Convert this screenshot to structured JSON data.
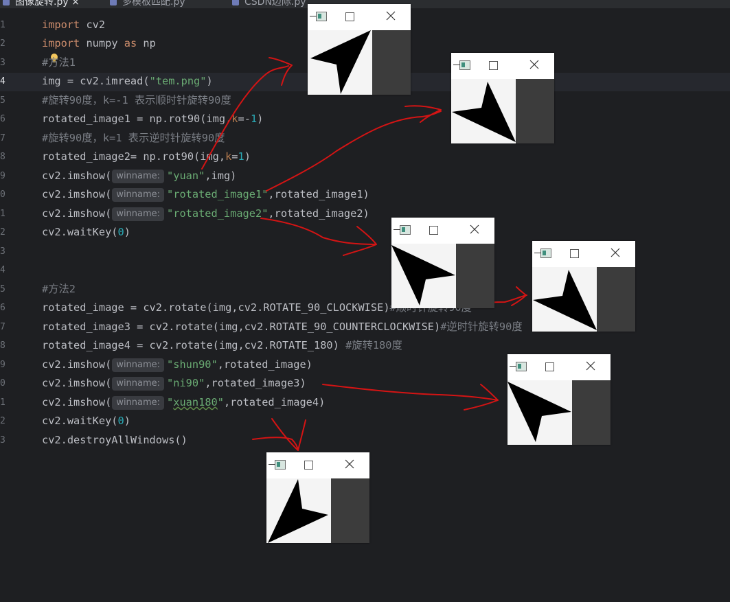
{
  "tabs": [
    {
      "label": "图像旋转.py",
      "active": true
    },
    {
      "label": "多模板匹配.py",
      "active": false
    },
    {
      "label": "CSDN边际.py",
      "active": false
    }
  ],
  "line_numbers": [
    "1",
    "2",
    "3",
    "4",
    "5",
    "6",
    "7",
    "8",
    "9",
    "0",
    "1",
    "2",
    "3",
    "4",
    "5",
    "6",
    "7",
    "8",
    "9",
    "0",
    "1",
    "2",
    "3"
  ],
  "current_line": 4,
  "hint_label": "winname:",
  "code": {
    "l1_kw": "import",
    "l1_rest": " cv2",
    "l2_kw1": "import",
    "l2_mid": " numpy ",
    "l2_kw2": "as",
    "l2_rest": " np",
    "l3_cm": "#方法1",
    "l4_pre": "img = cv2.imread(",
    "l4_str": "\"tem.png\"",
    "l4_post": ")",
    "l5_cm": "#旋转90度，k=-1 表示顺时针旋转90度",
    "l6_pre": "rotated_image1 = np.rot90(img,",
    "l6_prm": "k",
    "l6_eq": "=-",
    "l6_num": "1",
    "l6_post": ")",
    "l7_cm": "#旋转90度，k=1 表示逆时针旋转90度",
    "l8_pre": "rotated_image2= np.rot90(img,",
    "l8_prm": "k",
    "l8_eq": "=",
    "l8_num": "1",
    "l8_post": ")",
    "l9_pre": "cv2.imshow(",
    "l9_str": "\"yuan\"",
    "l9_post": ",img)",
    "l10_pre": "cv2.imshow(",
    "l10_str": "\"rotated_image1\"",
    "l10_post": ",rotated_image1)",
    "l11_pre": "cv2.imshow(",
    "l11_str": "\"rotated_image2\"",
    "l11_post": ",rotated_image2)",
    "l12_pre": "cv2.waitKey(",
    "l12_num": "0",
    "l12_post": ")",
    "l15_cm": "#方法2",
    "l16_code": "rotated_image = cv2.rotate(img,cv2.ROTATE_90_CLOCKWISE)",
    "l16_cm": "#顺时针旋转90度",
    "l17_code": "rotated_image3 = cv2.rotate(img,cv2.ROTATE_90_COUNTERCLOCKWISE)",
    "l17_cm": "#逆时针旋转90度",
    "l18_code": "rotated_image4 = cv2.rotate(img,cv2.ROTATE_180) ",
    "l18_cm": "#旋转180度",
    "l19_pre": "cv2.imshow(",
    "l19_str": "\"shun90\"",
    "l19_post": ",rotated_image)",
    "l20_pre": "cv2.imshow(",
    "l20_str": "\"ni90\"",
    "l20_post": ",rotated_image3)",
    "l21_pre": "cv2.imshow(",
    "l21_q1": "\"",
    "l21_str": "xuan180",
    "l21_q2": "\"",
    "l21_post": ",rotated_image4)",
    "l22_pre": "cv2.waitKey(",
    "l22_num": "0",
    "l22_post": ")",
    "l23_code": "cv2.destroyAllWindows()"
  },
  "colors": {
    "background": "#1e1f22",
    "keyword": "#cf8e6d",
    "string": "#6aab73",
    "number": "#2aacb8",
    "comment": "#7a7e85",
    "annotation_arrows": "#d41414",
    "image_dark_panel": "#3c3c3c"
  },
  "windows": [
    {
      "id": "win-yuan",
      "rotation": 0
    },
    {
      "id": "win-rotated-image1",
      "rotation": -90
    },
    {
      "id": "win-rotated-image2",
      "rotation": 90
    },
    {
      "id": "win-shun90",
      "rotation": -90
    },
    {
      "id": "win-ni90",
      "rotation": 90
    },
    {
      "id": "win-xuan180",
      "rotation": 180
    }
  ],
  "icons": {
    "app": "opencv-window-icon",
    "minimize": "maximize-icon",
    "close": "close-icon"
  }
}
